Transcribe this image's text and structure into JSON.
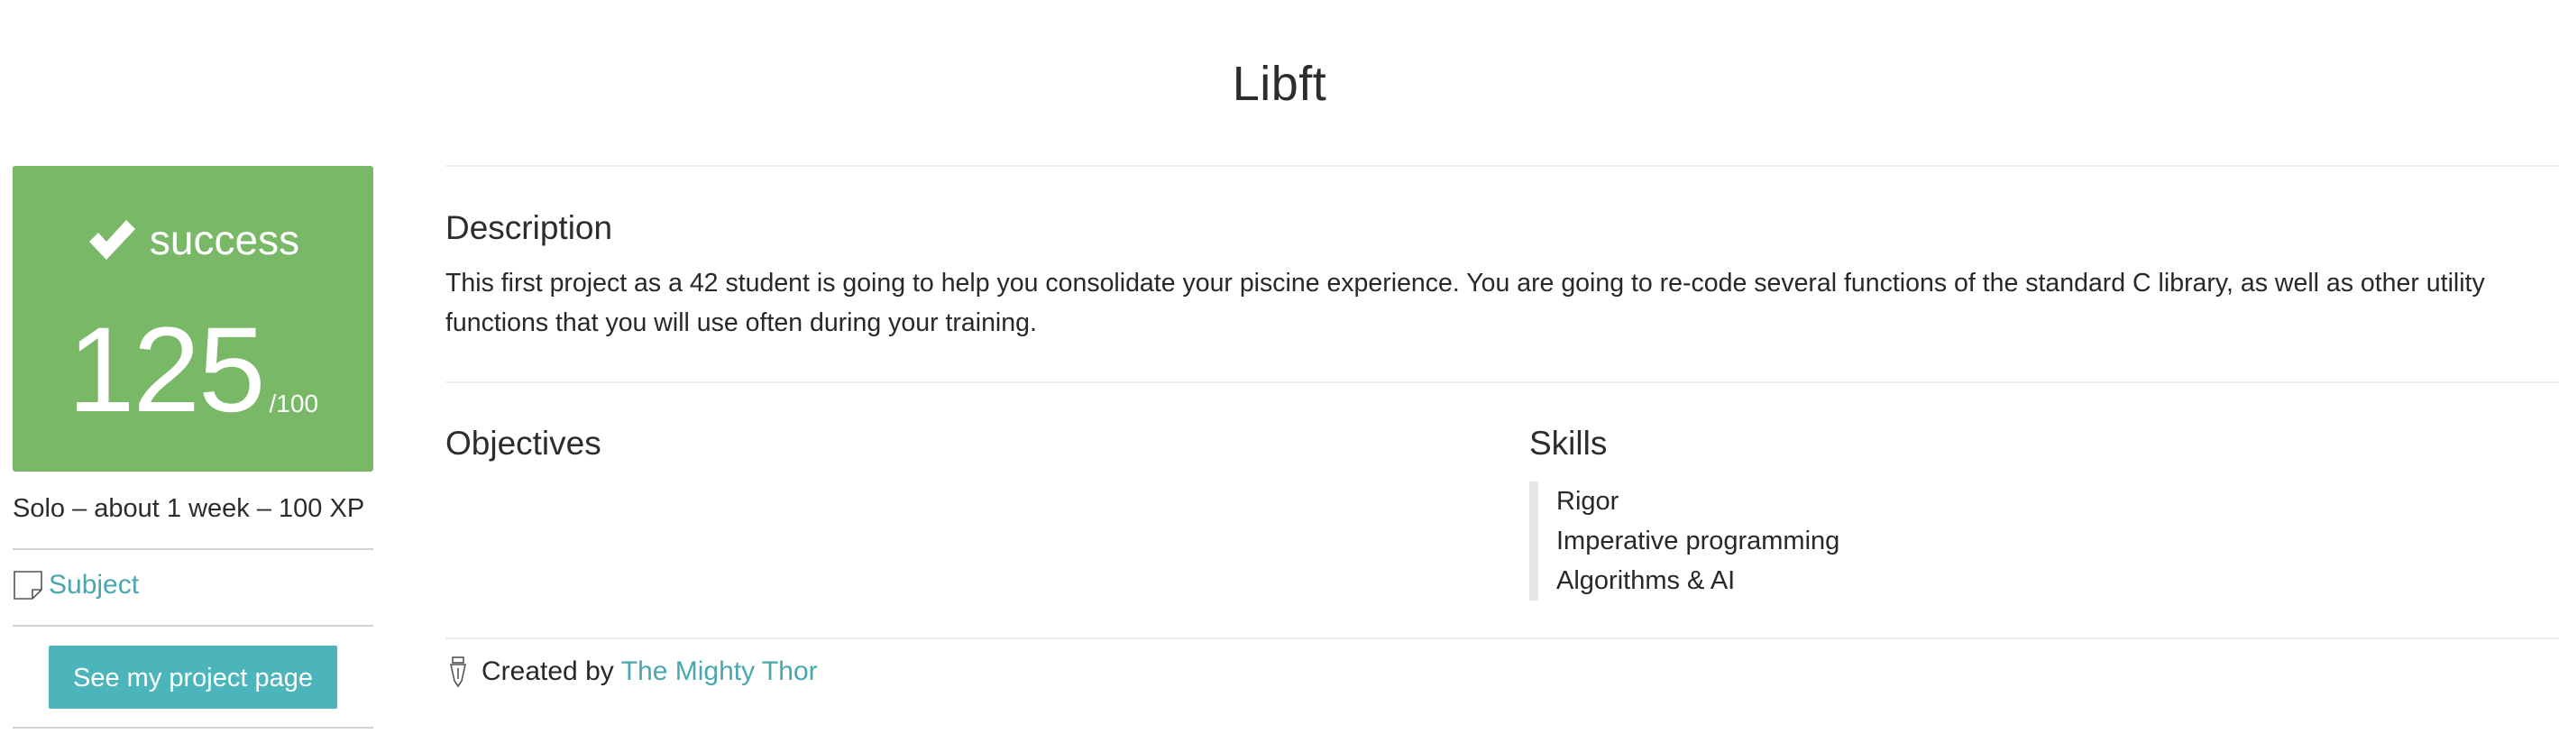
{
  "page": {
    "title": "Libft"
  },
  "sidebar": {
    "status": {
      "icon": "check-icon",
      "label": "success",
      "color": "#78b866"
    },
    "score": {
      "value": "125",
      "max": "/100"
    },
    "meta": "Solo – about 1 week – 100 XP",
    "subject": {
      "icon": "document-icon",
      "label": "Subject"
    },
    "project_button": {
      "label": "See my project page",
      "color": "#4bb5bb"
    }
  },
  "main": {
    "description": {
      "heading": "Description",
      "text": "This first project as a 42 student is going to help you consolidate your piscine experience. You are going to re-code several functions of the standard C library, as well as other utility functions that you will use often during your training."
    },
    "objectives": {
      "heading": "Objectives"
    },
    "skills": {
      "heading": "Skills",
      "items": [
        "Rigor",
        "Imperative programming",
        "Algorithms & AI"
      ]
    },
    "credit": {
      "icon": "pen-nib-icon",
      "prefix": "Created by",
      "author": "The Mighty Thor"
    }
  },
  "colors": {
    "link": "#4aa7ae",
    "success": "#78b866",
    "button": "#4bb5bb"
  }
}
